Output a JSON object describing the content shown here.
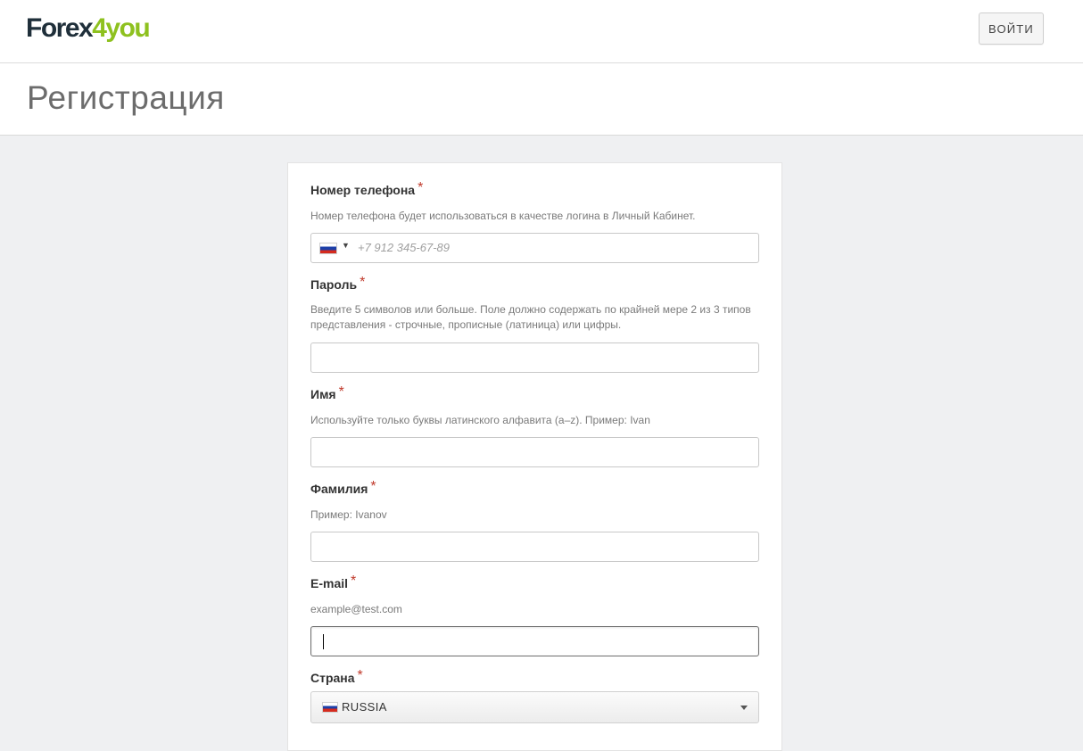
{
  "header": {
    "logo_part1": "Forex",
    "logo_part2": "4you",
    "login_label": "ВОЙТИ"
  },
  "page_title": "Регистрация",
  "form": {
    "phone": {
      "label": "Номер телефона",
      "hint": "Номер телефона будет использоваться в качестве логина в Личный Кабинет.",
      "placeholder": "+7 912 345-67-89",
      "country_icon": "russia-flag-icon"
    },
    "password": {
      "label": "Пароль",
      "hint": "Введите 5 символов или больше. Поле должно содержать по крайней мере 2 из 3 типов представления - строчные, прописные (латиница) или цифры.",
      "value": ""
    },
    "first_name": {
      "label": "Имя",
      "hint": "Используйте только буквы латинского алфавита (a–z). Пример: Ivan",
      "value": ""
    },
    "last_name": {
      "label": "Фамилия",
      "hint": "Пример: Ivanov",
      "value": ""
    },
    "email": {
      "label": "E-mail",
      "hint": "example@test.com",
      "value": ""
    },
    "country": {
      "label": "Страна",
      "selected": "RUSSIA"
    },
    "required_mark": "*"
  },
  "colors": {
    "brand_dark": "#1f2f3a",
    "brand_green": "#8ec11f",
    "required": "#c0392b",
    "background": "#eff0f2"
  }
}
